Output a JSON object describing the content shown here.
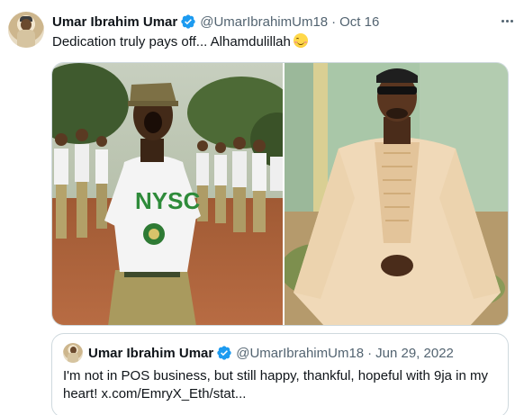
{
  "tweet": {
    "author_name": "Umar Ibrahim Umar",
    "handle": "@UmarIbrahimUm18",
    "separator": "·",
    "date": "Oct 16",
    "text": "Dedication truly pays off... Alhamdulillah",
    "emoji": "smiling-face-with-smiling-eyes",
    "photos": [
      {
        "description": "nysc-corps-member-shouting",
        "shirt_text": "NYSC"
      },
      {
        "description": "man-in-agbada-with-sunglasses"
      }
    ]
  },
  "quoted_tweet": {
    "author_name": "Umar Ibrahim Umar",
    "handle": "@UmarIbrahimUm18",
    "separator": "·",
    "date": "Jun 29, 2022",
    "text": "I'm not in POS business, but still happy, thankful, hopeful with 9ja in my heart! x.com/EmryX_Eth/stat..."
  },
  "colors": {
    "verified": "#1d9bf0",
    "secondary_text": "#536471",
    "border": "#cfd9de"
  }
}
